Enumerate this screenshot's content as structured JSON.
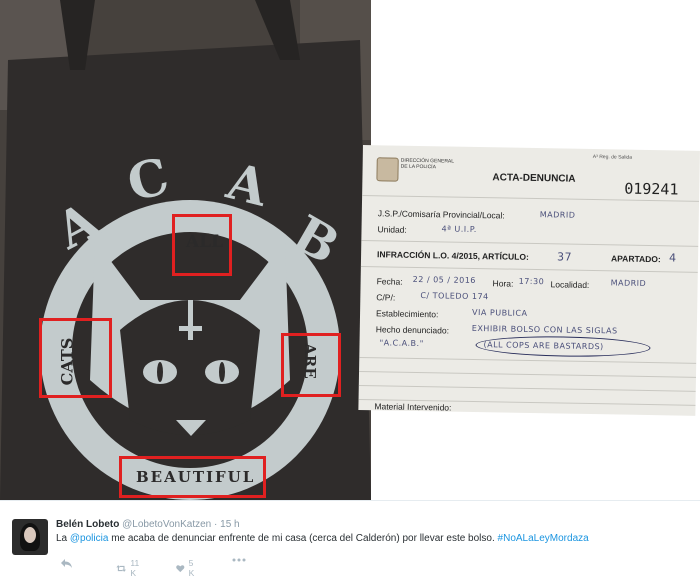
{
  "photo_bag": {
    "arc_letters": [
      "A",
      "C",
      "A",
      "B"
    ],
    "words": {
      "top": "ALL",
      "left": "CATS",
      "right": "ARE",
      "bottom": "BEAUTIFUL"
    },
    "highlight_color": "#e02020",
    "bag_color": "#3a3634",
    "print_color": "#c3cbcc"
  },
  "photo_doc": {
    "org": "DIRECCIÓN GENERAL\nDE LA POLICÍA",
    "corner": "A³ Reg. de Salida",
    "title": "ACTA-DENUNCIA",
    "number": "019241",
    "fields": {
      "jsp_label": "J.S.P./Comisaría Provincial/Local:",
      "jsp_value": "MADRID",
      "unidad_label": "Unidad:",
      "unidad_value": "4ª U.I.P.",
      "infraccion_label": "INFRACCIÓN L.O. 4/2015, ARTÍCULO:",
      "articulo_value": "37",
      "apartado_label": "APARTADO:",
      "apartado_value": "4",
      "fecha_label": "Fecha:",
      "fecha_value": "22 / 05 / 2016",
      "hora_label": "Hora:",
      "hora_value": "17:30",
      "localidad_label": "Localidad:",
      "localidad_value": "MADRID",
      "cp_label": "C/P/:",
      "cp_value": "C/ TOLEDO 174",
      "establecimiento_label": "Establecimiento:",
      "establecimiento_value": "VIA PUBLICA",
      "hecho_label": "Hecho denunciado:",
      "hecho_value_1": "EXHIBIR BOLSO CON LAS SIGLAS",
      "hecho_value_2": "\"A.C.A.B.\"",
      "hecho_value_3": "(ALL COPS ARE BASTARDS)",
      "material_label": "Material Intervenido:"
    }
  },
  "tweet": {
    "name": "Belén Lobeto",
    "handle": "@LobetoVonKatzen",
    "sep": "·",
    "time": "15 h",
    "text_before": "La ",
    "mention": "@policia",
    "text_middle": " me acaba de denunciar enfrente de mi casa (cerca del Calderón) por llevar este bolso. ",
    "hashtag": "#NoALaLeyMordaza",
    "retweet_count": "11 K",
    "like_count": "5 K",
    "icons": [
      "reply-icon",
      "retweet-icon",
      "heart-icon",
      "more-icon"
    ],
    "link_color": "#1b95e0"
  }
}
